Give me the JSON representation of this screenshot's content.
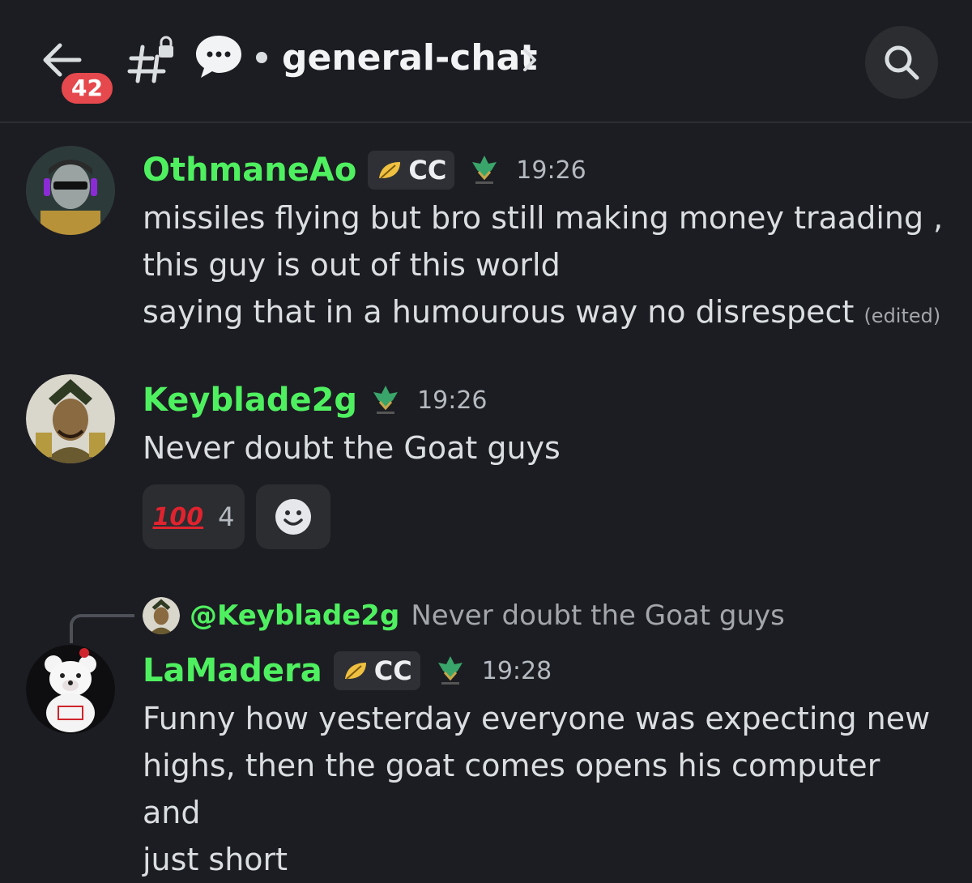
{
  "header": {
    "unread_count": "42",
    "channel_name": "general-chat",
    "back_icon": "arrow-left-icon",
    "channel_icon": "locked-hashtag-icon",
    "thread_icon": "chat-bubble-icon",
    "search_icon": "search-icon"
  },
  "messages": [
    {
      "username": "OthmaneAo",
      "tag": "CC",
      "time": "19:26",
      "lines": [
        "missiles flying but bro still making money traading ,",
        "this guy is out of this world",
        "saying that in a humourous way no disrespect"
      ],
      "edited": "(edited)"
    },
    {
      "username": "Keyblade2g",
      "time": "19:26",
      "lines": [
        "Never doubt the Goat guys"
      ],
      "reactions": [
        {
          "emoji": "100",
          "count": "4"
        }
      ]
    },
    {
      "reply_to": {
        "mention": "@Keyblade2g",
        "text": "Never doubt the Goat guys"
      },
      "username": "LaMadera",
      "tag": "CC",
      "time": "19:28",
      "lines": [
        "Funny how yesterday everyone was expecting new",
        "highs, then the goat comes opens his computer and",
        "just short"
      ]
    }
  ],
  "colors": {
    "background": "#1c1d22",
    "username": "#4ff060",
    "badge": "#e5484d",
    "reaction_emoji": "#e0232e"
  }
}
